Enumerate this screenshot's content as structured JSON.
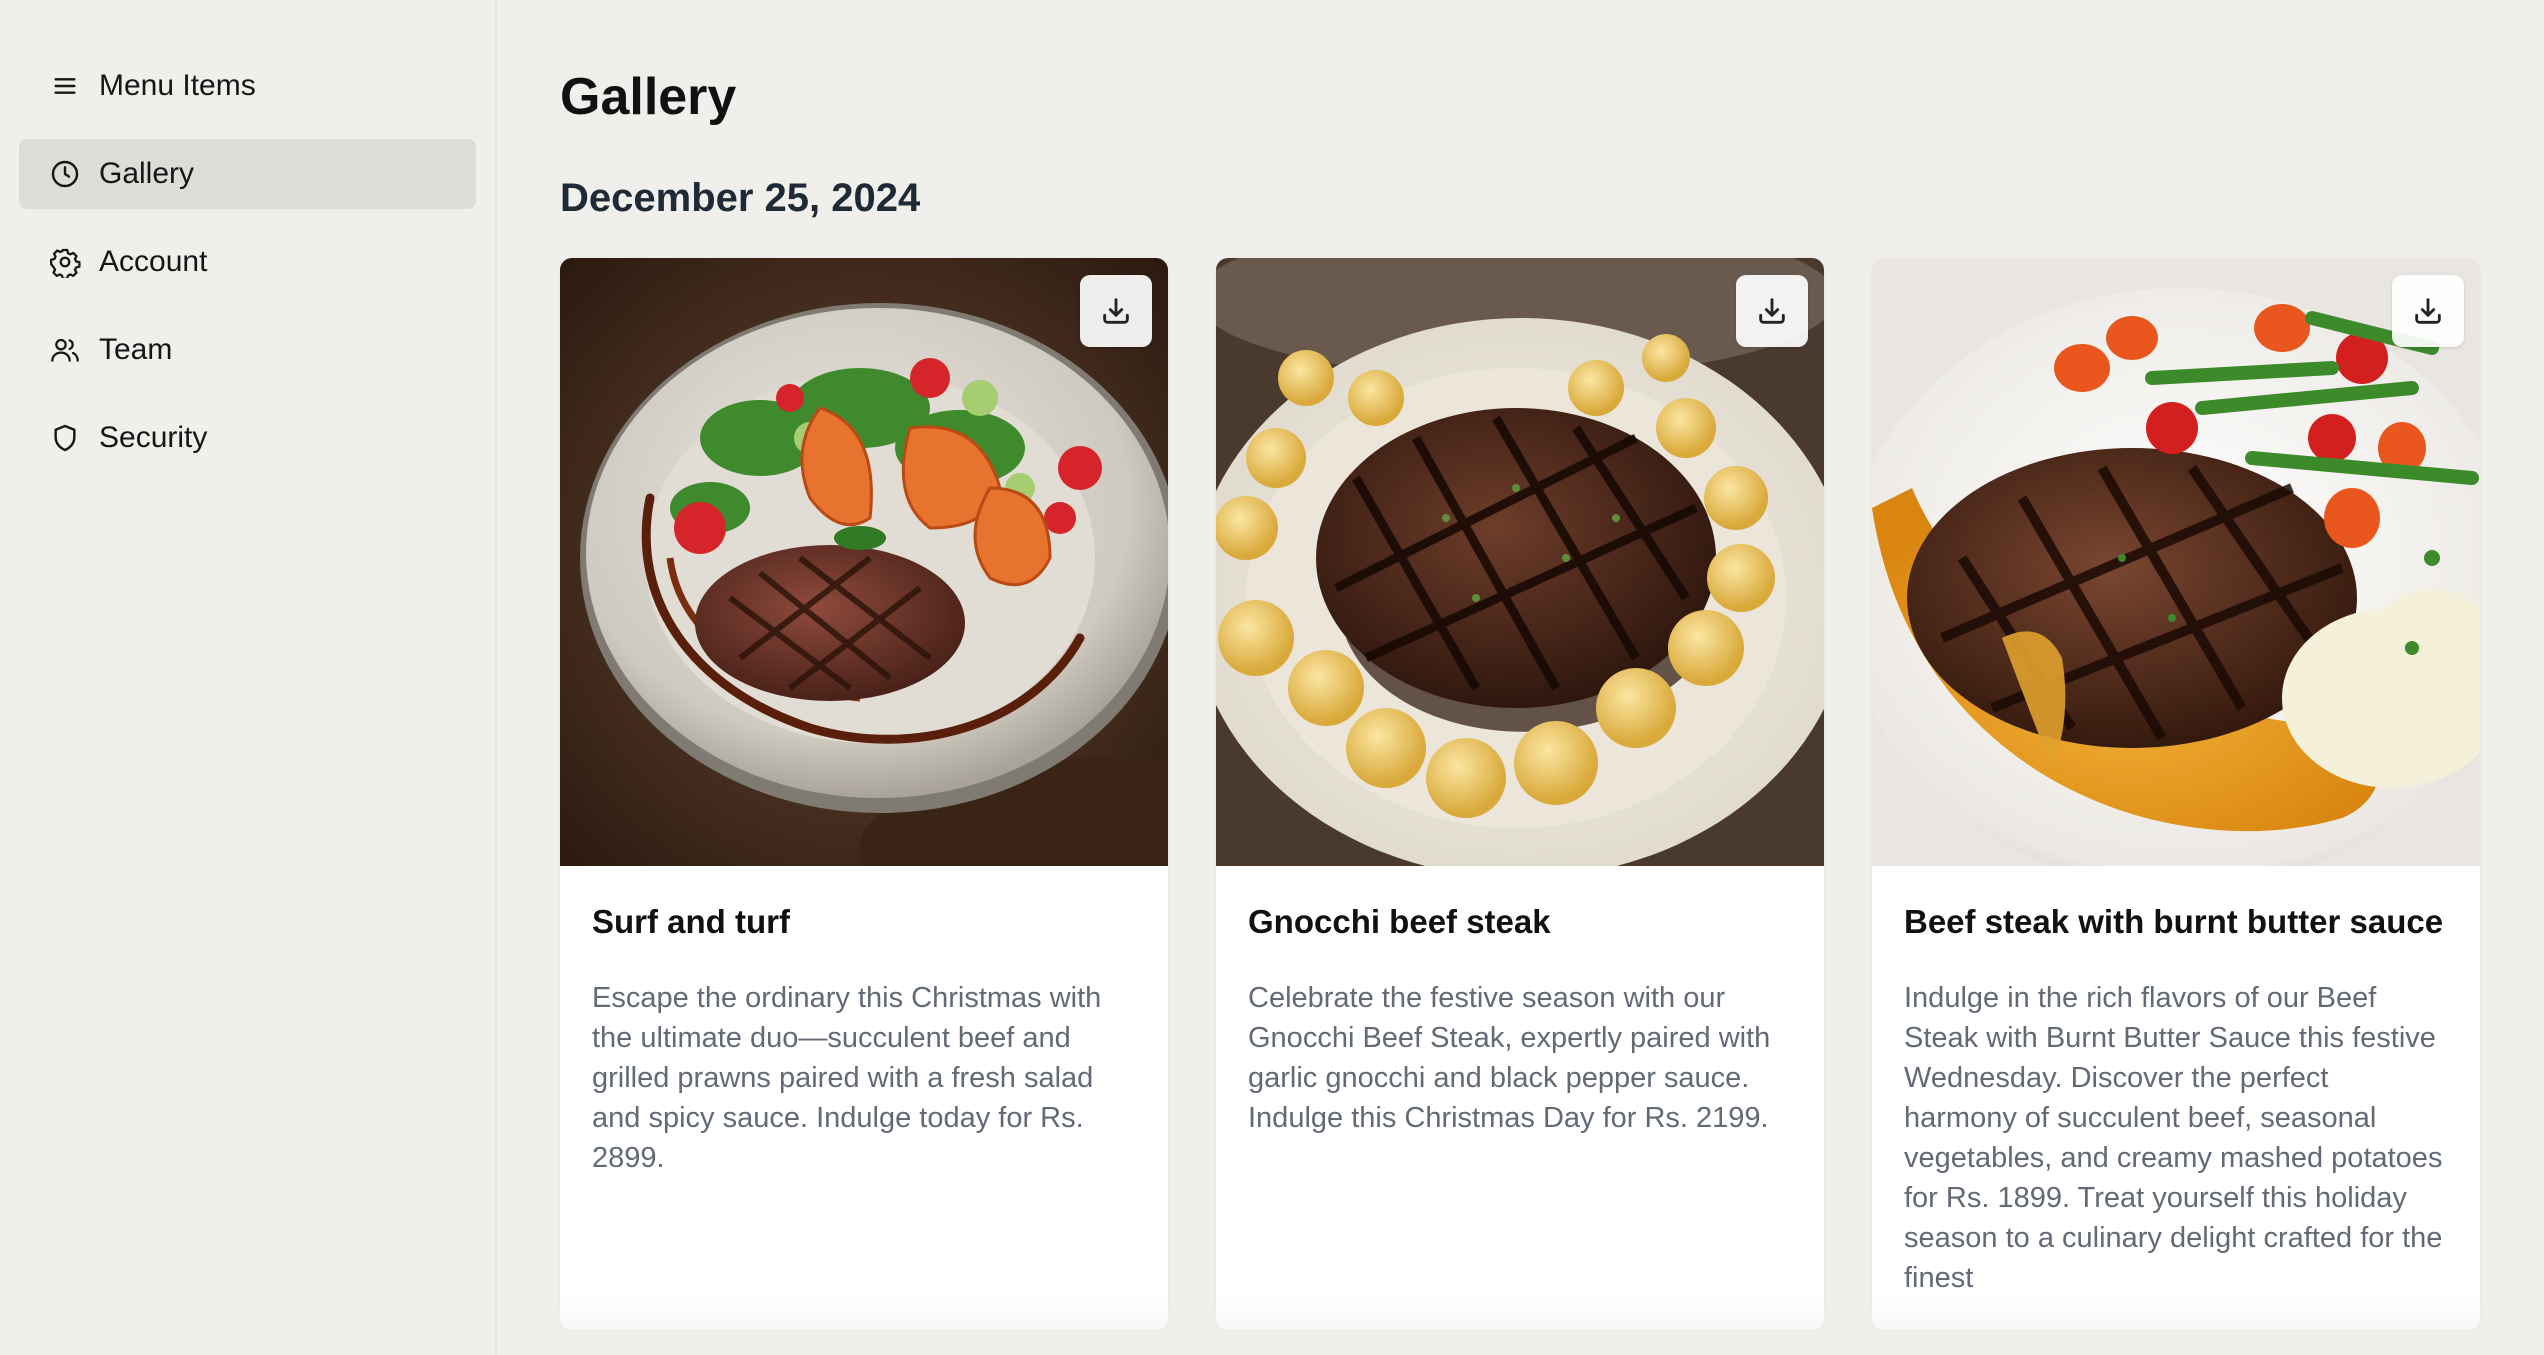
{
  "sidebar": {
    "items": [
      {
        "label": "Menu Items",
        "icon": "menu-icon",
        "active": false
      },
      {
        "label": "Gallery",
        "icon": "clock-icon",
        "active": true
      },
      {
        "label": "Account",
        "icon": "gear-icon",
        "active": false
      },
      {
        "label": "Team",
        "icon": "users-icon",
        "active": false
      },
      {
        "label": "Security",
        "icon": "shield-icon",
        "active": false
      }
    ]
  },
  "main": {
    "title": "Gallery",
    "date": "December 25, 2024",
    "cards": [
      {
        "title": "Surf and turf",
        "description": "Escape the ordinary this Christmas with the ultimate duo—succulent beef and grilled prawns paired with a fresh salad and spicy sauce. Indulge today for Rs. 2899.",
        "image_icon": "surf-and-turf-photo"
      },
      {
        "title": "Gnocchi beef steak",
        "description": "Celebrate the festive season with our Gnocchi Beef Steak, expertly paired with garlic gnocchi and black pepper sauce. Indulge this Christmas Day for Rs. 2199.",
        "image_icon": "gnocchi-steak-photo"
      },
      {
        "title": "Beef steak with burnt butter sauce",
        "description": "Indulge in the rich flavors of our Beef Steak with Burnt Butter Sauce this festive Wednesday. Discover the perfect harmony of succulent beef, seasonal vegetables, and creamy mashed potatoes for Rs. 1899. Treat yourself this holiday season to a culinary delight crafted for the finest",
        "image_icon": "butter-steak-photo"
      }
    ]
  },
  "colors": {
    "background": "#f0efeb",
    "active_nav": "#dcdcd8",
    "card": "#ffffff",
    "description_text": "#626a75"
  }
}
